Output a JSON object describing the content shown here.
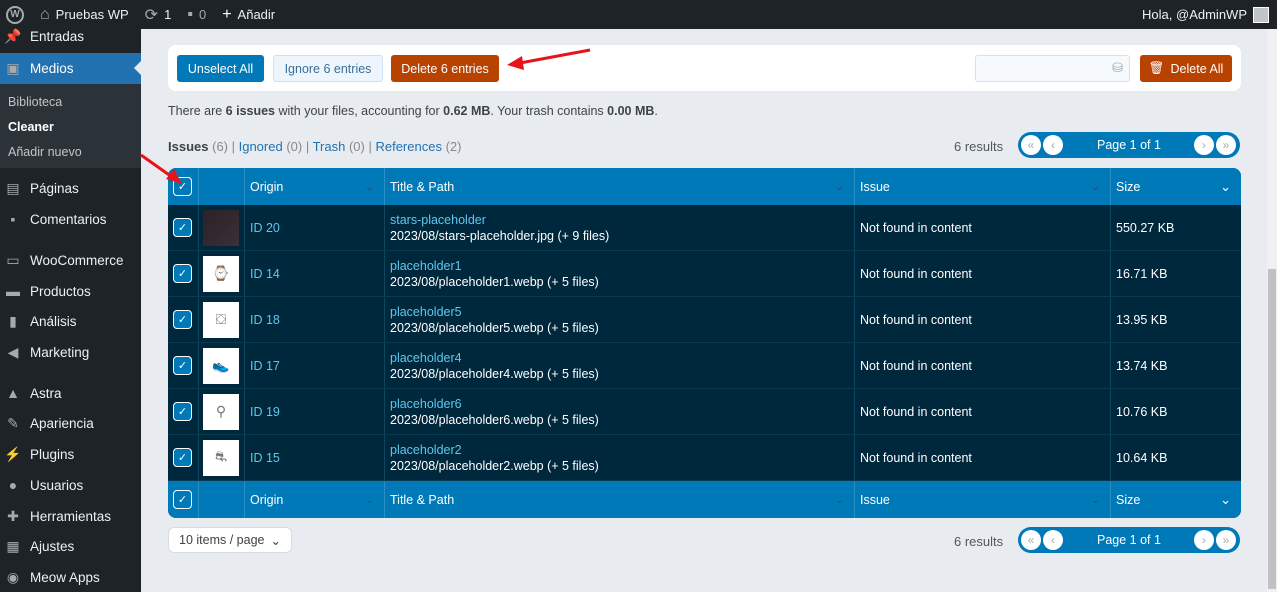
{
  "adminbar": {
    "site": "Pruebas WP",
    "updates": "1",
    "comments": "0",
    "new": "Añadir",
    "greeting": "Hola, @AdminWP"
  },
  "sidebar": {
    "items": [
      {
        "label": "Entradas",
        "icon": "pin-icon"
      },
      {
        "label": "Medios",
        "icon": "media-icon",
        "active": true
      },
      {
        "label": "Páginas",
        "icon": "pages-icon"
      },
      {
        "label": "Comentarios",
        "icon": "comment-icon"
      },
      {
        "label": "WooCommerce",
        "icon": "woo-icon"
      },
      {
        "label": "Productos",
        "icon": "box-icon"
      },
      {
        "label": "Análisis",
        "icon": "chart-icon"
      },
      {
        "label": "Marketing",
        "icon": "megaphone-icon"
      },
      {
        "label": "Astra",
        "icon": "astra-icon"
      },
      {
        "label": "Apariencia",
        "icon": "brush-icon"
      },
      {
        "label": "Plugins",
        "icon": "plug-icon"
      },
      {
        "label": "Usuarios",
        "icon": "user-icon"
      },
      {
        "label": "Herramientas",
        "icon": "wrench-icon"
      },
      {
        "label": "Ajustes",
        "icon": "settings-icon"
      },
      {
        "label": "Meow Apps",
        "icon": "meow-icon"
      }
    ],
    "submenu": [
      "Biblioteca",
      "Cleaner",
      "Añadir nuevo"
    ]
  },
  "toolbar": {
    "unselect": "Unselect All",
    "ignore": "Ignore 6 entries",
    "delete": "Delete 6 entries",
    "search_placeholder": "",
    "delete_all": "Delete All"
  },
  "summary": {
    "pre": "There are ",
    "issues": "6 issues",
    "mid": " with your files, accounting for ",
    "size": "0.62 MB",
    "mid2": ". Your trash contains ",
    "trash": "0.00 MB",
    "end": "."
  },
  "tabs": [
    {
      "label": "Issues",
      "count": "(6)"
    },
    {
      "label": "Ignored",
      "count": "(0)"
    },
    {
      "label": "Trash",
      "count": "(0)"
    },
    {
      "label": "References",
      "count": "(2)"
    }
  ],
  "results": "6 results",
  "pager": "Page 1 of 1",
  "columns": [
    "Origin",
    "Title & Path",
    "Issue",
    "Size"
  ],
  "rows": [
    {
      "origin": "ID 20",
      "title": "stars-placeholder",
      "path": "2023/08/stars-placeholder.jpg (+ 9 files)",
      "issue": "Not found in content",
      "size": "550.27 KB"
    },
    {
      "origin": "ID 14",
      "title": "placeholder1",
      "path": "2023/08/placeholder1.webp (+ 5 files)",
      "issue": "Not found in content",
      "size": "16.71 KB"
    },
    {
      "origin": "ID 18",
      "title": "placeholder5",
      "path": "2023/08/placeholder5.webp (+ 5 files)",
      "issue": "Not found in content",
      "size": "13.95 KB"
    },
    {
      "origin": "ID 17",
      "title": "placeholder4",
      "path": "2023/08/placeholder4.webp (+ 5 files)",
      "issue": "Not found in content",
      "size": "13.74 KB"
    },
    {
      "origin": "ID 19",
      "title": "placeholder6",
      "path": "2023/08/placeholder6.webp (+ 5 files)",
      "issue": "Not found in content",
      "size": "10.76 KB"
    },
    {
      "origin": "ID 15",
      "title": "placeholder2",
      "path": "2023/08/placeholder2.webp (+ 5 files)",
      "issue": "Not found in content",
      "size": "10.64 KB"
    }
  ],
  "per_page": "10 items / page",
  "colors": {
    "primary": "#0079b8",
    "danger": "#b84200",
    "table_bg": "#00283d",
    "sidebar": "#1d2327"
  }
}
